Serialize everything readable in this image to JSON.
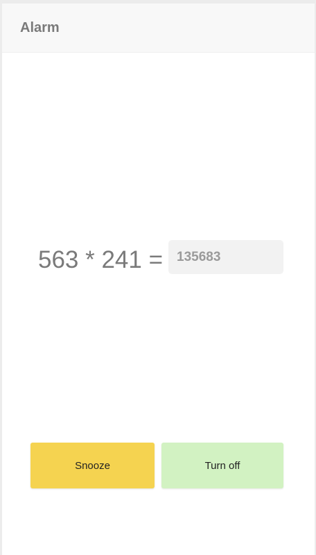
{
  "header": {
    "title": "Alarm"
  },
  "challenge": {
    "question": "563 * 241 =",
    "answer_value": "135683"
  },
  "actions": {
    "snooze_label": "Snooze",
    "turn_off_label": "Turn off"
  },
  "colors": {
    "snooze_bg": "#f5d350",
    "turn_off_bg": "#d2f2c2",
    "text_gray": "#7a7a7a"
  }
}
